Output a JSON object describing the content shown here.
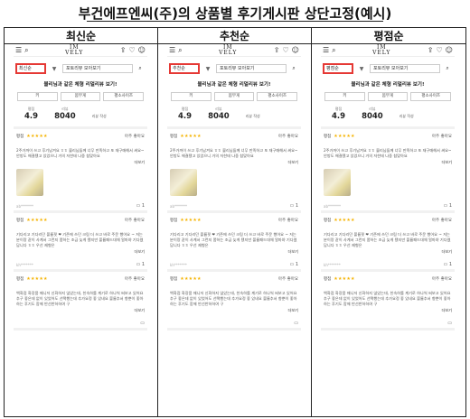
{
  "page_title": "부건에프엔씨(주)의 상품별 후기게시판 상단고정(예시)",
  "columns": [
    {
      "header": "최신순",
      "sort_value": "최신순",
      "album_label": "포토리뷰 모아보기",
      "promo": "블리님과 같은 체형 리얼리뷰 보기!",
      "options": [
        "키",
        "몸무게",
        "평소사이즈"
      ],
      "stats": {
        "rating_label": "평점",
        "rating": "4.9",
        "reviews_label": "리뷰",
        "reviews": "8040",
        "view_all": "리뷰 작성"
      },
      "reviews": [
        {
          "eval_label": "평점",
          "verdict": "아주 좋아요",
          "text": "2주가까이 쓰고 후기남겨요 ㅎㅎ 블리님들께 너무 만족하고 또 재구매해서 써요~ 안방도 해결됐고 있었으니 거의 저한테 나중 참맞아요",
          "more": "더보기",
          "author": "ab*******",
          "comments": "1",
          "thumb": true
        },
        {
          "eval_label": "평점",
          "verdict": "아주 좋아요",
          "text": "기다리고 기다리던 볼륨핏 ❤ 기존에 쓰던 크림 더 쓰고 바로 주문 했어요 ~ 저는 분이랑 같이 사계서 그런지 쫌하는 조금 늦게 됐지만 볼륨패드대체 얼마야 기다렸답니다 ㅎㅎ 우선 제형은",
          "more": "더보기",
          "author": "kh*******",
          "comments": "1",
          "thumb": false
        },
        {
          "eval_label": "평점",
          "verdict": "아주 좋아요",
          "text": "백화점 화장품 매니저 신화하지 않았는데, 친숙하를 계기로 하나씩 써보고 있어요 추구 좋은데 없이 있었어도 선택했는데 추가요정 좋 있네요 볼륨추서 향뿐이 좋아하는 후기도 함께 반선반하하여 구",
          "more": "더보기",
          "author": "",
          "comments": "",
          "thumb": false
        }
      ]
    },
    {
      "header": "추천순",
      "sort_value": "추천순",
      "album_label": "포토리뷰 모아보기",
      "promo": "블리님과 같은 체형 리얼리뷰 보기!",
      "options": [
        "키",
        "몸무게",
        "평소사이즈"
      ],
      "stats": {
        "rating_label": "평점",
        "rating": "4.9",
        "reviews_label": "리뷰",
        "reviews": "8040",
        "view_all": "리뷰 작성"
      },
      "reviews": [
        {
          "eval_label": "평점",
          "verdict": "아주 좋아요",
          "text": "2주가까이 쓰고 후기남겨요 ㅎㅎ 블리님들께 너무 만족하고 또 재구매해서 써요~ 안방도 해결됐고 있었으니 거의 저한테 나중 참맞아요",
          "more": "더보기",
          "author": "ab*******",
          "comments": "1",
          "thumb": true
        },
        {
          "eval_label": "평점",
          "verdict": "아주 좋아요",
          "text": "기다리고 기다리던 볼륨핏 ❤ 기존에 쓰던 크림 더 쓰고 바로 주문 했어요 ~ 저는 분이랑 같이 사계서 그런지 쫌하는 조금 늦게 됐지만 볼륨패드대체 얼마야 기다렸답니다 ㅎㅎ 우선 제형은",
          "more": "더보기",
          "author": "kh*******",
          "comments": "1",
          "thumb": false
        },
        {
          "eval_label": "평점",
          "verdict": "아주 좋아요",
          "text": "백화점 화장품 매니저 신화하지 않았는데, 친숙하를 계기로 하나씩 써보고 있어요 추구 좋은데 없이 있었어도 선택했는데 추가요정 좋 있네요 볼륨추서 향뿐이 좋아하는 후기도 함께 반선반하하여 구",
          "more": "더보기",
          "author": "",
          "comments": "",
          "thumb": false
        }
      ]
    },
    {
      "header": "평점순",
      "sort_value": "평점순",
      "album_label": "포토리뷰 모아보기",
      "promo": "블리님과 같은 체형 리얼리뷰 보기!",
      "options": [
        "키",
        "몸무게",
        "평소사이즈"
      ],
      "stats": {
        "rating_label": "평점",
        "rating": "4.9",
        "reviews_label": "리뷰",
        "reviews": "8040",
        "view_all": "리뷰 작성"
      },
      "reviews": [
        {
          "eval_label": "평점",
          "verdict": "아주 좋아요",
          "text": "2주가까이 쓰고 후기남겨요 ㅎㅎ 블리님들께 너무 만족하고 또 재구매해서 써요~ 안방도 해결됐고 있었으니 거의 저한테 나중 참맞아요",
          "more": "더보기",
          "author": "ab*******",
          "comments": "1",
          "thumb": true
        },
        {
          "eval_label": "평점",
          "verdict": "아주 좋아요",
          "text": "기다리고 기다리던 볼륨핏 ❤ 기존에 쓰던 크림 더 쓰고 바로 주문 했어요 ~ 저는 분이랑 같이 사계서 그런지 쫌하는 조금 늦게 됐지만 볼륨패드대체 얼마야 기다렸답니다 ㅎㅎ 우선 제형은",
          "more": "더보기",
          "author": "kh*******",
          "comments": "1",
          "thumb": false
        },
        {
          "eval_label": "평점",
          "verdict": "아주 좋아요",
          "text": "백화점 화장품 매니저 신화하지 않았는데, 친숙하를 계기로 하나씩 써보고 있어요 추구 좋은데 없이 있었어도 선택했는데 추가요정 좋 있네요 볼륨추서 향뿐이 좋아하는 후기도 함께 반선반하하여 구",
          "more": "더보기",
          "author": "",
          "comments": "",
          "thumb": false
        }
      ]
    }
  ],
  "app": {
    "logo_line1": "IM",
    "logo_line2": "VELY"
  },
  "icons": {
    "menu": "menu-icon",
    "search": "search-icon",
    "share": "share-icon",
    "cart": "cart-icon",
    "user": "user-icon",
    "chevron": "chevron-down-icon",
    "comment": "comment-icon"
  },
  "colors": {
    "highlight": "#e53935",
    "star": "#f5b301"
  }
}
